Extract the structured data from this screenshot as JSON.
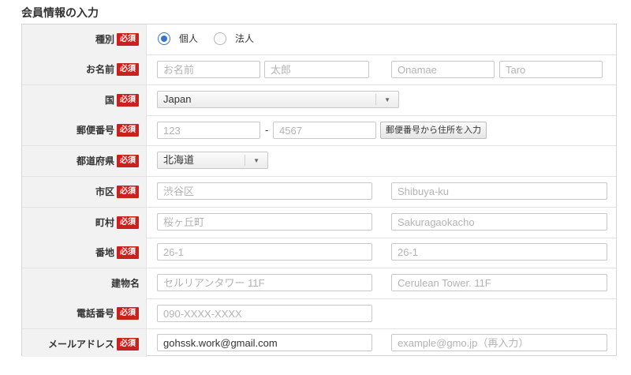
{
  "section_title": "会員情報の入力",
  "required_badge": "必須",
  "fields": {
    "type": {
      "label": "種別",
      "options": [
        "個人",
        "法人"
      ],
      "selected": "個人"
    },
    "name": {
      "label": "お名前",
      "last_placeholder": "お名前",
      "first_placeholder": "太郎",
      "last_roman_placeholder": "Onamae",
      "first_roman_placeholder": "Taro"
    },
    "country": {
      "label": "国",
      "value": "Japan"
    },
    "postal": {
      "label": "郵便番号",
      "placeholder1": "123",
      "separator": "-",
      "placeholder2": "4567",
      "lookup_button": "郵便番号から住所を入力"
    },
    "prefecture": {
      "label": "都道府県",
      "value": "北海道"
    },
    "city": {
      "label": "市区",
      "placeholder": "渋谷区",
      "roman_placeholder": "Shibuya-ku"
    },
    "town": {
      "label": "町村",
      "placeholder": "桜ヶ丘町",
      "roman_placeholder": "Sakuragaokacho"
    },
    "street": {
      "label": "番地",
      "placeholder": "26-1",
      "roman_placeholder": "26-1"
    },
    "building": {
      "label": "建物名",
      "placeholder": "セルリアンタワー 11F",
      "roman_placeholder": "Cerulean Tower. 11F"
    },
    "phone": {
      "label": "電話番号",
      "placeholder": "090-XXXX-XXXX"
    },
    "email": {
      "label": "メールアドレス",
      "value": "gohssk.work@gmail.com",
      "confirm_placeholder": "example@gmo.jp（再入力）"
    }
  },
  "colors": {
    "required_badge": "#c9211e",
    "radio_selected": "#3b73c9",
    "label_background": "#f2f2f2"
  }
}
